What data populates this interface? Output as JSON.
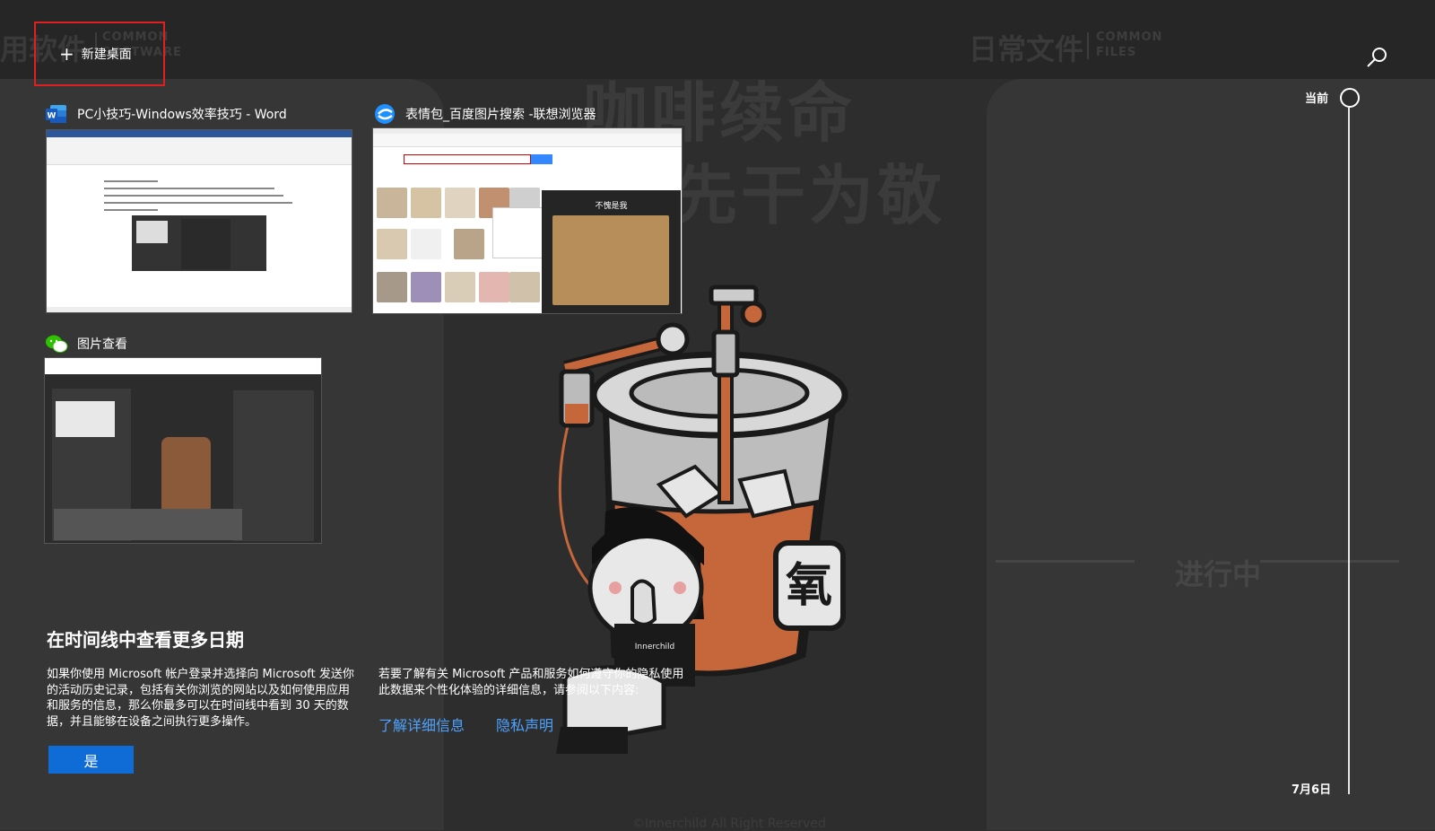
{
  "background": {
    "left_heading_cn": "用软件",
    "left_heading_en": "COMMON SOFTWARE",
    "right_heading_cn": "日常文件",
    "right_heading_en": "COMMON FILES",
    "slogan_line1": "咖啡续命",
    "slogan_line2": "先干为敬",
    "progress_text": "进行中",
    "copyright": "©Innerchild All Right Reserved",
    "can_label": "氧",
    "shirt_label": "Innerchild"
  },
  "toolbar": {
    "new_desktop_label": "新建桌面",
    "new_desktop_icon": "plus-icon",
    "search_icon": "search-icon"
  },
  "windows": [
    {
      "title": "PC小技巧-Windows效率技巧 - Word",
      "icon": "word-icon"
    },
    {
      "title": "表情包_百度图片搜索 -联想浏览器",
      "icon": "lenovo-browser-icon",
      "thumb_caption": "不愧是我"
    },
    {
      "title": "图片查看",
      "icon": "wechat-icon"
    }
  ],
  "info": {
    "title": "在时间线中查看更多日期",
    "text_left": "如果你使用 Microsoft 帐户登录并选择向 Microsoft 发送你的活动历史记录，包括有关你浏览的网站以及如何使用应用和服务的信息，那么你最多可以在时间线中看到 30 天的数据，并且能够在设备之间执行更多操作。",
    "text_right": "若要了解有关 Microsoft 产品和服务如何遵守你的隐私使用此数据来个性化体验的详细信息，请参阅以下内容:",
    "link_learn_more": "了解详细信息",
    "link_privacy": "隐私声明",
    "yes_button": "是"
  },
  "timeline": {
    "current_label": "当前",
    "date_label": "7月6日"
  }
}
